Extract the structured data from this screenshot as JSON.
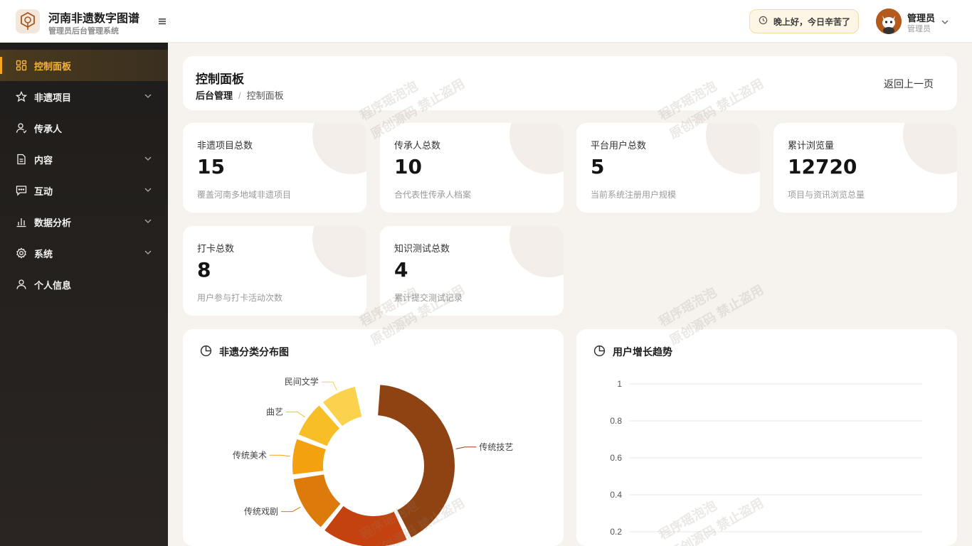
{
  "header": {
    "brand_title": "河南非遗数字图谱",
    "brand_subtitle": "管理员后台管理系统",
    "greeting": "晚上好，今日辛苦了",
    "user_name": "管理员",
    "user_role": "管理员"
  },
  "sidebar": {
    "items": [
      {
        "label": "控制面板",
        "icon": "dashboard-icon",
        "active": true
      },
      {
        "label": "非遗项目",
        "icon": "star-icon",
        "expandable": true
      },
      {
        "label": "传承人",
        "icon": "user-icon"
      },
      {
        "label": "内容",
        "icon": "document-icon",
        "expandable": true
      },
      {
        "label": "互动",
        "icon": "chat-icon",
        "expandable": true
      },
      {
        "label": "数据分析",
        "icon": "bar-chart-icon",
        "expandable": true
      },
      {
        "label": "系统",
        "icon": "gear-icon",
        "expandable": true
      },
      {
        "label": "个人信息",
        "icon": "person-icon"
      }
    ]
  },
  "page": {
    "title": "控制面板",
    "breadcrumb_root": "后台管理",
    "breadcrumb_sep": "/",
    "breadcrumb_current": "控制面板",
    "back_label": "返回上一页"
  },
  "stats": [
    {
      "label": "非遗项目总数",
      "value": "15",
      "desc": "覆盖河南多地域非遗项目"
    },
    {
      "label": "传承人总数",
      "value": "10",
      "desc": "合代表性传承人档案"
    },
    {
      "label": "平台用户总数",
      "value": "5",
      "desc": "当前系统注册用户规模"
    },
    {
      "label": "累计浏览量",
      "value": "12720",
      "desc": "项目与资讯浏览总量"
    },
    {
      "label": "打卡总数",
      "value": "8",
      "desc": "用户参与打卡活动次数"
    },
    {
      "label": "知识测试总数",
      "value": "4",
      "desc": "累计提交测试记录"
    }
  ],
  "watermark": {
    "line1": "程序瑶泡泡",
    "line2": "原创源码 禁止盗用"
  },
  "colors": {
    "accent": "#f5a623",
    "sidebar_bg": "#1f1d1b"
  },
  "chart_data": [
    {
      "type": "pie",
      "title": "非遗分类分布图",
      "categories": [
        "传统技艺",
        "传统戏剧",
        "传统美术",
        "曲艺",
        "民间文学"
      ],
      "visible_labels": [
        "传统技艺",
        "传统戏剧",
        "传统美术",
        "曲艺",
        "民间文学"
      ],
      "colors": [
        "#8f4312",
        "#c4420f",
        "#dc7b0c",
        "#f3a10f",
        "#f7bf25",
        "#fbd24e"
      ],
      "slices": [
        {
          "label": "传统技艺",
          "share": 0.42
        },
        {
          "label": "",
          "share": 0.18
        },
        {
          "label": "传统戏剧",
          "share": 0.12
        },
        {
          "label": "传统美术",
          "share": 0.08
        },
        {
          "label": "曲艺",
          "share": 0.08
        },
        {
          "label": "民间文学",
          "share": 0.08
        }
      ]
    },
    {
      "type": "line",
      "title": "用户增长趋势",
      "y_ticks": [
        "1",
        "0.8",
        "0.6",
        "0.4",
        "0.2"
      ],
      "ylim": [
        0,
        1
      ],
      "grid": true
    }
  ]
}
